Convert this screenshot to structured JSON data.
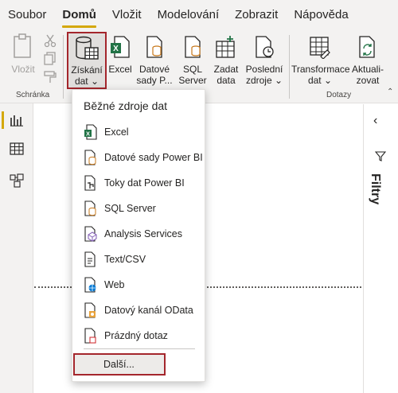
{
  "menu": {
    "tabs": [
      {
        "label": "Soubor"
      },
      {
        "label": "Domů"
      },
      {
        "label": "Vložit"
      },
      {
        "label": "Modelování"
      },
      {
        "label": "Zobrazit"
      },
      {
        "label": "Nápověda"
      }
    ],
    "active_tab": "Domů"
  },
  "ribbon": {
    "paste_label": "Vložit",
    "clipboard_group": "Schránka",
    "get_data_line1": "Získání",
    "get_data_line2": "dat ⌄",
    "excel_label": "Excel",
    "datasets_line1": "Datové",
    "datasets_line2": "sady P...",
    "sql_line1": "SQL",
    "sql_line2": "Server",
    "enter_data_line1": "Zadat",
    "enter_data_line2": "data",
    "recent_line1": "Poslední",
    "recent_line2": "zdroje ⌄",
    "transform_line1": "Transformace",
    "transform_line2": "dat ⌄",
    "refresh_line1": "Aktuali-",
    "refresh_line2": "zovat",
    "queries_group": "Dotazy"
  },
  "dropdown": {
    "heading": "Běžné zdroje dat",
    "items": [
      {
        "label": "Excel",
        "icon": "excel-icon"
      },
      {
        "label": "Datové sady Power BI",
        "icon": "dataset-icon"
      },
      {
        "label": "Toky dat Power BI",
        "icon": "dataflow-icon"
      },
      {
        "label": "SQL Server",
        "icon": "sql-server-icon"
      },
      {
        "label": "Analysis Services",
        "icon": "analysis-services-icon"
      },
      {
        "label": "Text/CSV",
        "icon": "text-csv-icon"
      },
      {
        "label": "Web",
        "icon": "web-icon"
      },
      {
        "label": "Datový kanál OData",
        "icon": "odata-icon"
      },
      {
        "label": "Prázdný dotaz",
        "icon": "blank-query-icon"
      }
    ],
    "more_label": "Další..."
  },
  "filters_pane": {
    "label": "Filtry"
  },
  "colors": {
    "accent": "#d4a80a",
    "highlight_border": "#a4262c",
    "excel_green": "#217346"
  }
}
